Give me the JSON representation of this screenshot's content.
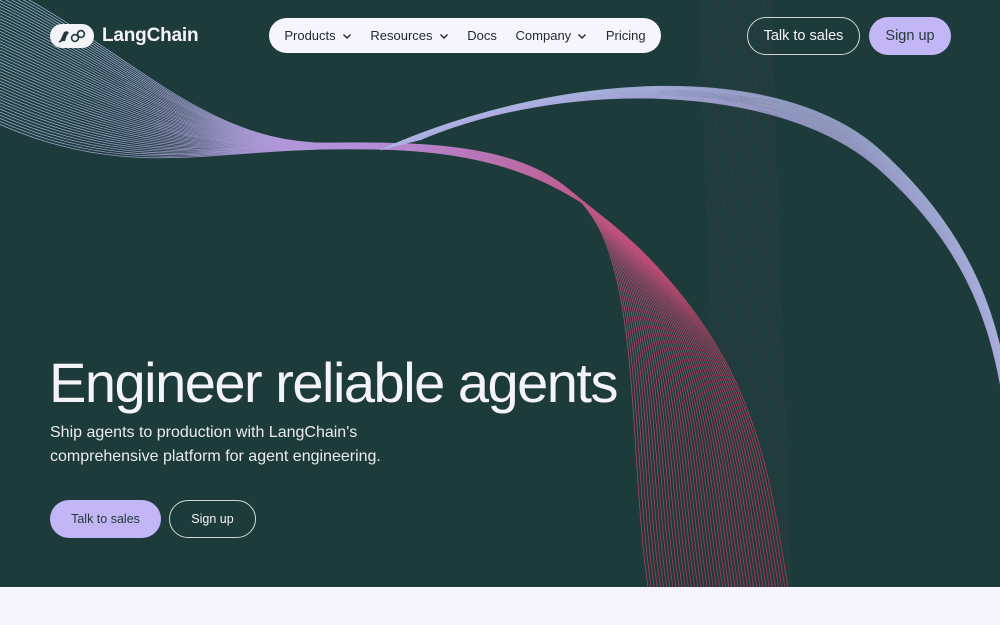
{
  "brand": {
    "name": "LangChain",
    "logo_icon": "parrot-chain-icon"
  },
  "nav": {
    "items": [
      {
        "label": "Products",
        "has_dropdown": true
      },
      {
        "label": "Resources",
        "has_dropdown": true
      },
      {
        "label": "Docs",
        "has_dropdown": false
      },
      {
        "label": "Company",
        "has_dropdown": true
      },
      {
        "label": "Pricing",
        "has_dropdown": false
      }
    ]
  },
  "header": {
    "talk_label": "Talk to sales",
    "signup_label": "Sign up"
  },
  "hero": {
    "title": "Engineer reliable agents",
    "subtitle": "Ship agents to production with LangChain's comprehensive platform for agent engineering.",
    "cta_primary": "Talk to sales",
    "cta_secondary": "Sign up"
  },
  "colors": {
    "background": "#1e3b3b",
    "accent": "#c2b6f6",
    "wave_blue": "#aac6e8",
    "wave_purple": "#b48cd8",
    "wave_red": "#c8304a",
    "lower_band": "#f6f5fd"
  }
}
